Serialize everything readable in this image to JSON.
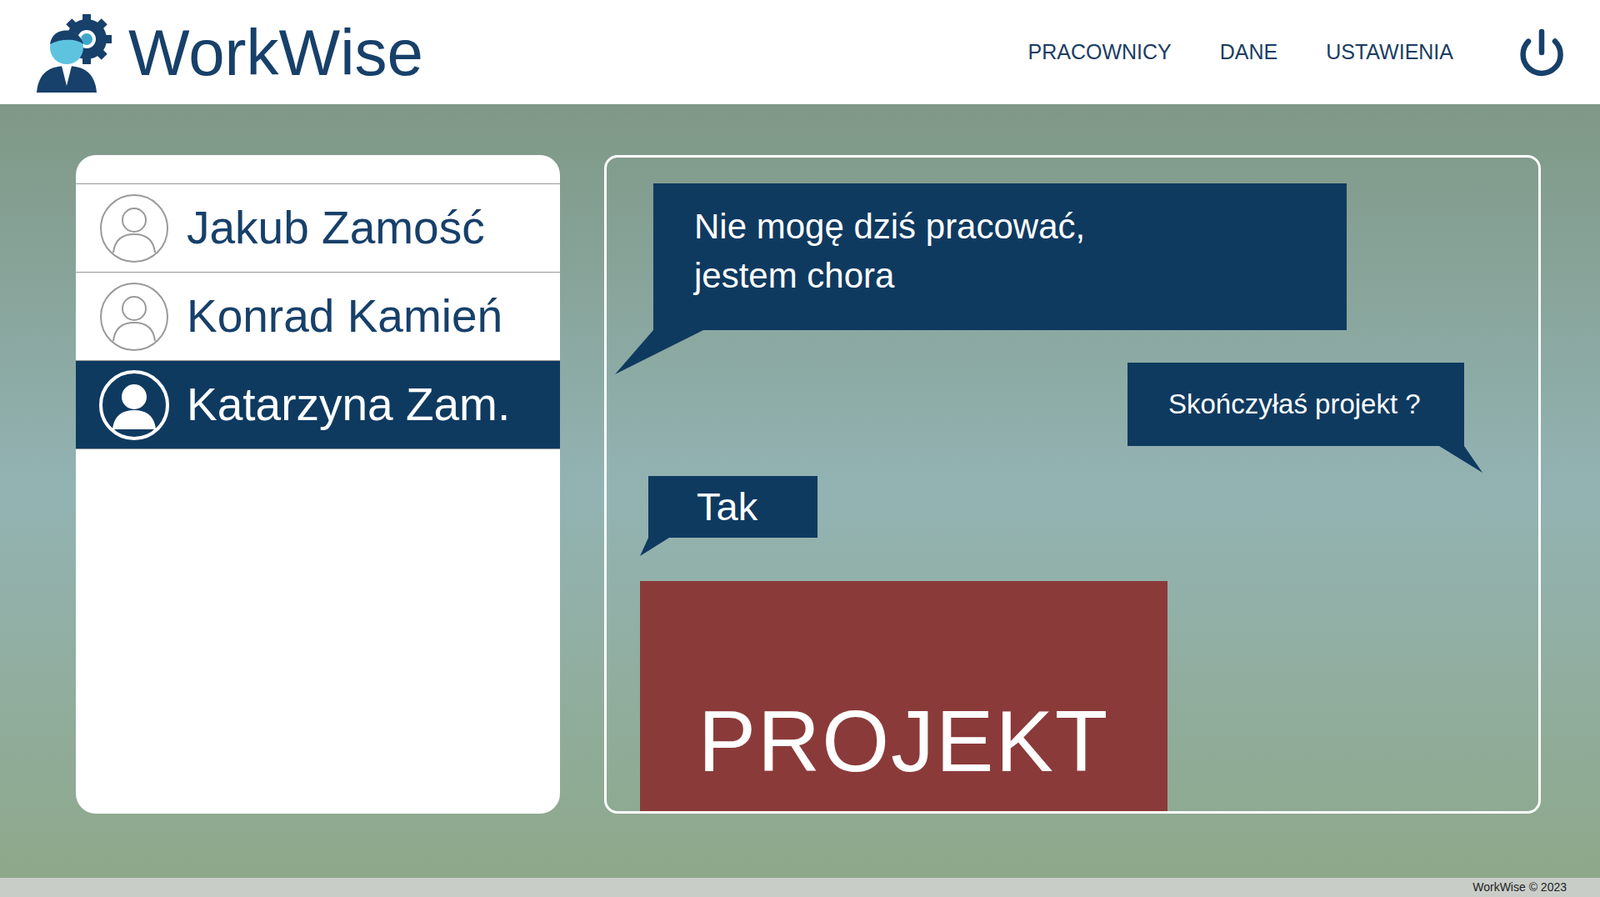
{
  "app": {
    "logo": "WorkWise"
  },
  "nav": [
    {
      "label": "PRACOWNICY"
    },
    {
      "label": "DANE"
    },
    {
      "label": "USTAWIENIA"
    }
  ],
  "employees": [
    {
      "name": "Jakub Zamość",
      "selected": false
    },
    {
      "name": "Konrad Kamień",
      "selected": false
    },
    {
      "name": "Katarzyna Zam.",
      "selected": true
    }
  ],
  "chat": {
    "messages": [
      {
        "kind": "incoming",
        "lines": [
          "Nie mogę dziś pracować,",
          "jestem chora"
        ]
      },
      {
        "kind": "outgoing",
        "lines": [
          "Skończyłaś projekt ?"
        ]
      },
      {
        "kind": "incoming",
        "lines": [
          "Tak"
        ]
      }
    ],
    "project": {
      "label": "PROJEKT"
    }
  },
  "footer": {
    "text": "WorkWise © 2023"
  }
}
